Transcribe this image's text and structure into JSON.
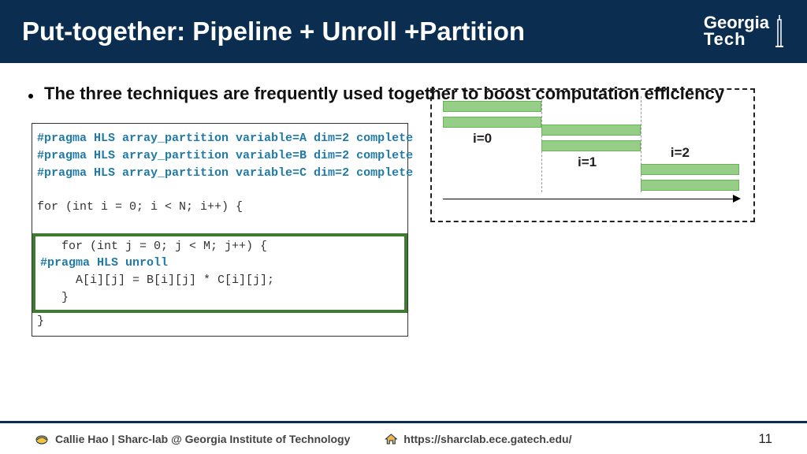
{
  "header": {
    "title": "Put-together: Pipeline + Unroll +Partition",
    "logo_line1": "Georgia",
    "logo_line2": "Tech"
  },
  "bullet": "The three techniques are frequently used together to boost computation efficiency",
  "code": {
    "pragma_a": "#pragma HLS array_partition variable=A dim=2 complete",
    "pragma_b": "#pragma HLS array_partition variable=B dim=2 complete",
    "pragma_c": "#pragma HLS array_partition variable=C dim=2 complete",
    "for_outer": "for (int i = 0; i < N; i++) {",
    "for_inner": "   for (int j = 0; j < M; j++) {",
    "pragma_unroll": "#pragma HLS unroll",
    "assign": "     A[i][j] = B[i][j] * C[i][j];",
    "close_inner": "   }",
    "close_outer": "}"
  },
  "diagram": {
    "labels": {
      "i0": "i=0",
      "i1": "i=1",
      "i2": "i=2"
    }
  },
  "footer": {
    "left": "Callie Hao | Sharc-lab @ Georgia Institute of Technology",
    "url": "https://sharclab.ece.gatech.edu/",
    "page": "11"
  }
}
